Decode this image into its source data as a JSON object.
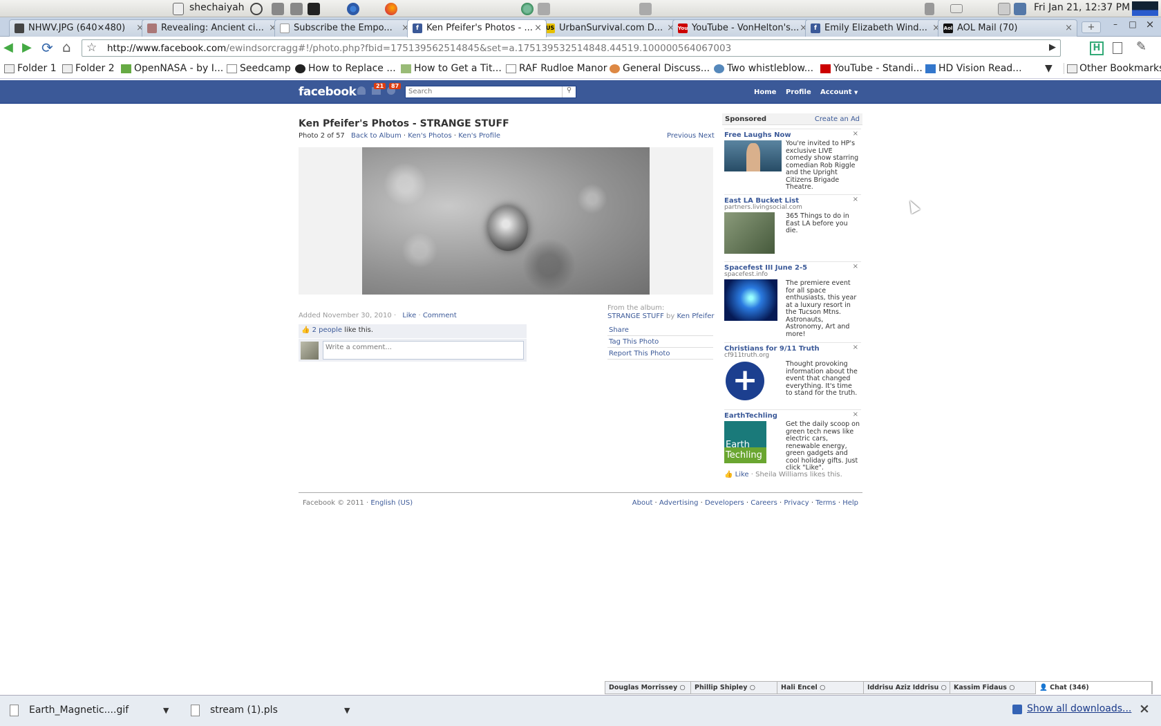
{
  "system": {
    "username": "shechaiyah",
    "clock": "Fri Jan 21, 12:37 PM"
  },
  "tabs": [
    {
      "title": "NHWV.JPG (640×480)",
      "color": "#444"
    },
    {
      "title": "Revealing: Ancient ci...",
      "color": "#a77"
    },
    {
      "title": "Subscribe the Empo...",
      "color": "#ddd"
    },
    {
      "title": "Ken Pfeifer's Photos - ...",
      "color": "#3b5998",
      "icon": "f"
    },
    {
      "title": "UrbanSurvival.com D...",
      "color": "#e6c000",
      "icon": "US"
    },
    {
      "title": "YouTube - VonHelton's...",
      "color": "#c00",
      "icon": "You"
    },
    {
      "title": "Emily Elizabeth Wind...",
      "color": "#3b5998",
      "icon": "f"
    },
    {
      "title": "AOL Mail (70)",
      "color": "#111",
      "icon": "Aol"
    }
  ],
  "url": {
    "domain": "http://www.facebook.com",
    "path": "/ewindsorcragg#!/photo.php?fbid=175139562514845&set=a.175139532514848.44519.100000564067003"
  },
  "bookmarks": [
    {
      "label": "Folder 1"
    },
    {
      "label": "Folder 2"
    },
    {
      "label": "OpenNASA - by I..."
    },
    {
      "label": "Seedcamp"
    },
    {
      "label": "How to Replace ..."
    },
    {
      "label": "How to Get a Tit..."
    },
    {
      "label": "RAF Rudloe Manor"
    },
    {
      "label": "General Discuss..."
    },
    {
      "label": "Two whistleblow..."
    },
    {
      "label": "YouTube - Standi..."
    },
    {
      "label": "HD Vision Read..."
    }
  ],
  "other_bookmarks": "Other Bookmarks",
  "fb": {
    "logo": "facebook",
    "badge_messages": "21",
    "badge_notifications": "87",
    "search_placeholder": "Search",
    "nav_home": "Home",
    "nav_profile": "Profile",
    "nav_account": "Account"
  },
  "photo": {
    "page_title": "Ken Pfeifer's Photos - STRANGE STUFF",
    "counter": "Photo 2 of 57",
    "back_album": "Back to Album",
    "kens_photos": "Ken's Photos",
    "kens_profile": "Ken's Profile",
    "previous": "Previous",
    "next": "Next",
    "added": "Added November 30, 2010",
    "like": "Like",
    "comment": "Comment",
    "likes_count": "2 people",
    "likes_suffix": " like this.",
    "comment_placeholder": "Write a comment...",
    "from_album": "From the album:",
    "album_name": "STRANGE STUFF",
    "by": "by",
    "owner": "Ken Pfeifer",
    "share": "Share",
    "tag": "Tag This Photo",
    "report": "Report This Photo"
  },
  "sidebar": {
    "sponsored": "Sponsored",
    "create_ad": "Create an Ad",
    "ads": [
      {
        "title": "Free Laughs Now",
        "domain": "",
        "body": "You're invited to HP's exclusive LIVE comedy show starring comedian Rob Riggle and the Upright Citizens Brigade Theatre."
      },
      {
        "title": "East LA Bucket List",
        "domain": "partners.livingsocial.com",
        "body": "365 Things to do in East LA before you die."
      },
      {
        "title": "Spacefest III June 2-5",
        "domain": "spacefest.info",
        "body": "The premiere event for all space enthusiasts, this year at a luxury resort in the Tucson Mtns. Astronauts, Astronomy, Art and more!"
      },
      {
        "title": "Christians for 9/11 Truth",
        "domain": "cf911truth.org",
        "body": "Thought provoking information about the event that changed everything. It's time to stand for the truth."
      },
      {
        "title": "EarthTechling",
        "domain": "",
        "body": "Get the daily scoop on green tech news like electric cars, renewable energy, green gadgets and cool holiday gifts. Just click \"Like\"."
      }
    ],
    "earth_logo_1": "Earth",
    "earth_logo_2": "Techling",
    "like": "Like",
    "like_by": "· Sheila Williams likes this."
  },
  "footer": {
    "copyright": "Facebook © 2011 ·",
    "language": "English (US)",
    "links": [
      "About",
      "Advertising",
      "Developers",
      "Careers",
      "Privacy",
      "Terms",
      "Help"
    ]
  },
  "chat": {
    "friends": [
      "Douglas Morrissey",
      "Phillip Shipley",
      "Hali Encel",
      "Iddrisu Aziz Iddrisu",
      "Kassim Fidaus"
    ],
    "label": "Chat (346)"
  },
  "downloads": {
    "items": [
      "Earth_Magnetic....gif",
      "stream (1).pls"
    ],
    "show_all": "Show all downloads..."
  }
}
